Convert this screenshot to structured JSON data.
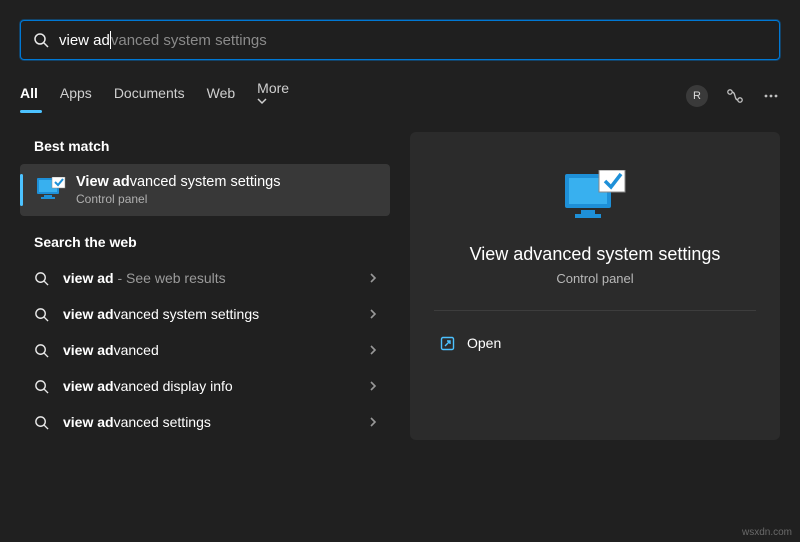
{
  "search": {
    "typed": "view ad",
    "completion": "vanced system settings"
  },
  "tabs": {
    "all": "All",
    "apps": "Apps",
    "documents": "Documents",
    "web": "Web",
    "more": "More"
  },
  "avatar_letter": "R",
  "sections": {
    "best_match": "Best match",
    "search_web": "Search the web"
  },
  "best_match": {
    "prefix": "View ad",
    "rest": "vanced system settings",
    "subtitle": "Control panel"
  },
  "web_results": [
    {
      "prefix": "view ad",
      "rest": "",
      "extra": " - See web results"
    },
    {
      "prefix": "view ad",
      "rest": "vanced system settings",
      "extra": ""
    },
    {
      "prefix": "view ad",
      "rest": "vanced",
      "extra": ""
    },
    {
      "prefix": "view ad",
      "rest": "vanced display info",
      "extra": ""
    },
    {
      "prefix": "view ad",
      "rest": "vanced settings",
      "extra": ""
    }
  ],
  "preview": {
    "title": "View advanced system settings",
    "subtitle": "Control panel",
    "open": "Open"
  },
  "watermark": "wsxdn.com"
}
